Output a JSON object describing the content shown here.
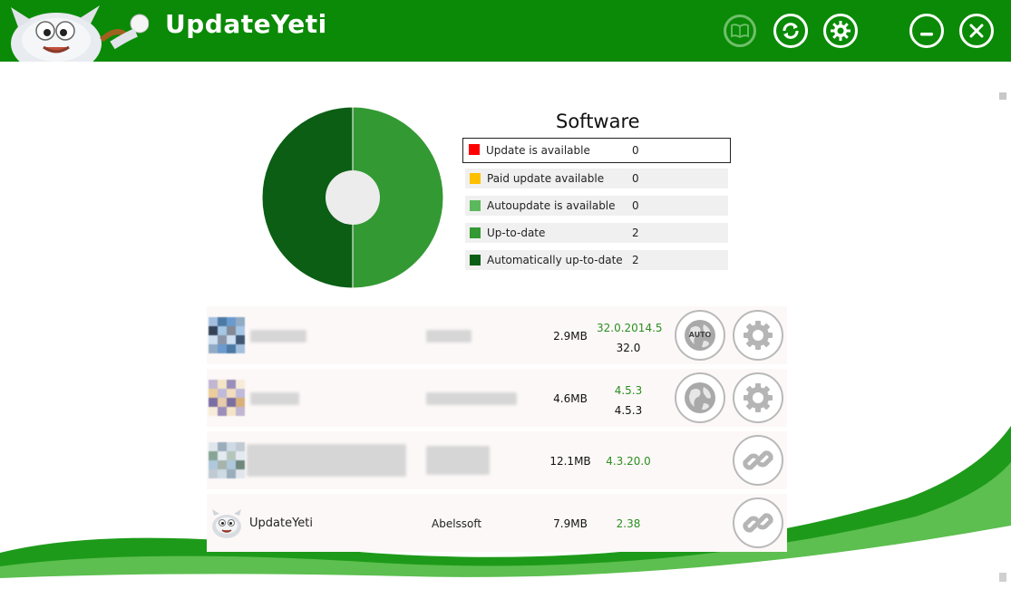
{
  "header": {
    "title": "UpdateYeti",
    "buttons": [
      {
        "name": "book-icon"
      },
      {
        "name": "refresh-icon"
      },
      {
        "name": "gear-icon"
      },
      {
        "name": "minimize-icon"
      },
      {
        "name": "close-icon"
      }
    ]
  },
  "summary": {
    "title": "Software",
    "legend": [
      {
        "label": "Update is available",
        "count": "0",
        "color": "#ff0000",
        "selected": true
      },
      {
        "label": "Paid update available",
        "count": "0",
        "color": "#ffc000"
      },
      {
        "label": "Autoupdate is available",
        "count": "0",
        "color": "#5cb85c"
      },
      {
        "label": "Up-to-date",
        "count": "2",
        "color": "#339933"
      },
      {
        "label": "Automatically up-to-date",
        "count": "2",
        "color": "#0b5e14"
      }
    ],
    "chart_data": {
      "type": "pie",
      "categories": [
        "Update is available",
        "Paid update available",
        "Autoupdate is available",
        "Up-to-date",
        "Automatically up-to-date"
      ],
      "values": [
        0,
        0,
        0,
        2,
        2
      ],
      "colors": [
        "#ff0000",
        "#ffc000",
        "#5cb85c",
        "#339933",
        "#0b5e14"
      ]
    }
  },
  "software": [
    {
      "name": "",
      "vendor": "",
      "size": "2.9MB",
      "latest": "32.0.2014.5",
      "installed": "32.0",
      "actions": [
        "auto-update-globe-icon",
        "gear-icon"
      ],
      "auto_label": "AUTO"
    },
    {
      "name": "",
      "vendor": "",
      "size": "4.6MB",
      "latest": "4.5.3",
      "installed": "4.5.3",
      "actions": [
        "globe-icon",
        "gear-icon"
      ]
    },
    {
      "name": "",
      "vendor": "",
      "size": "12.1MB",
      "latest": "4.3.20.0",
      "installed": "",
      "actions": [
        "link-icon"
      ]
    },
    {
      "name": "UpdateYeti",
      "vendor": "Abelssoft",
      "size": "7.9MB",
      "latest": "2.38",
      "installed": "",
      "actions": [
        "link-icon"
      ]
    }
  ],
  "colors": {
    "header_bg": "#0a8a06",
    "row_bg": "#fdf8f8",
    "version_green": "#2a8f1f"
  }
}
